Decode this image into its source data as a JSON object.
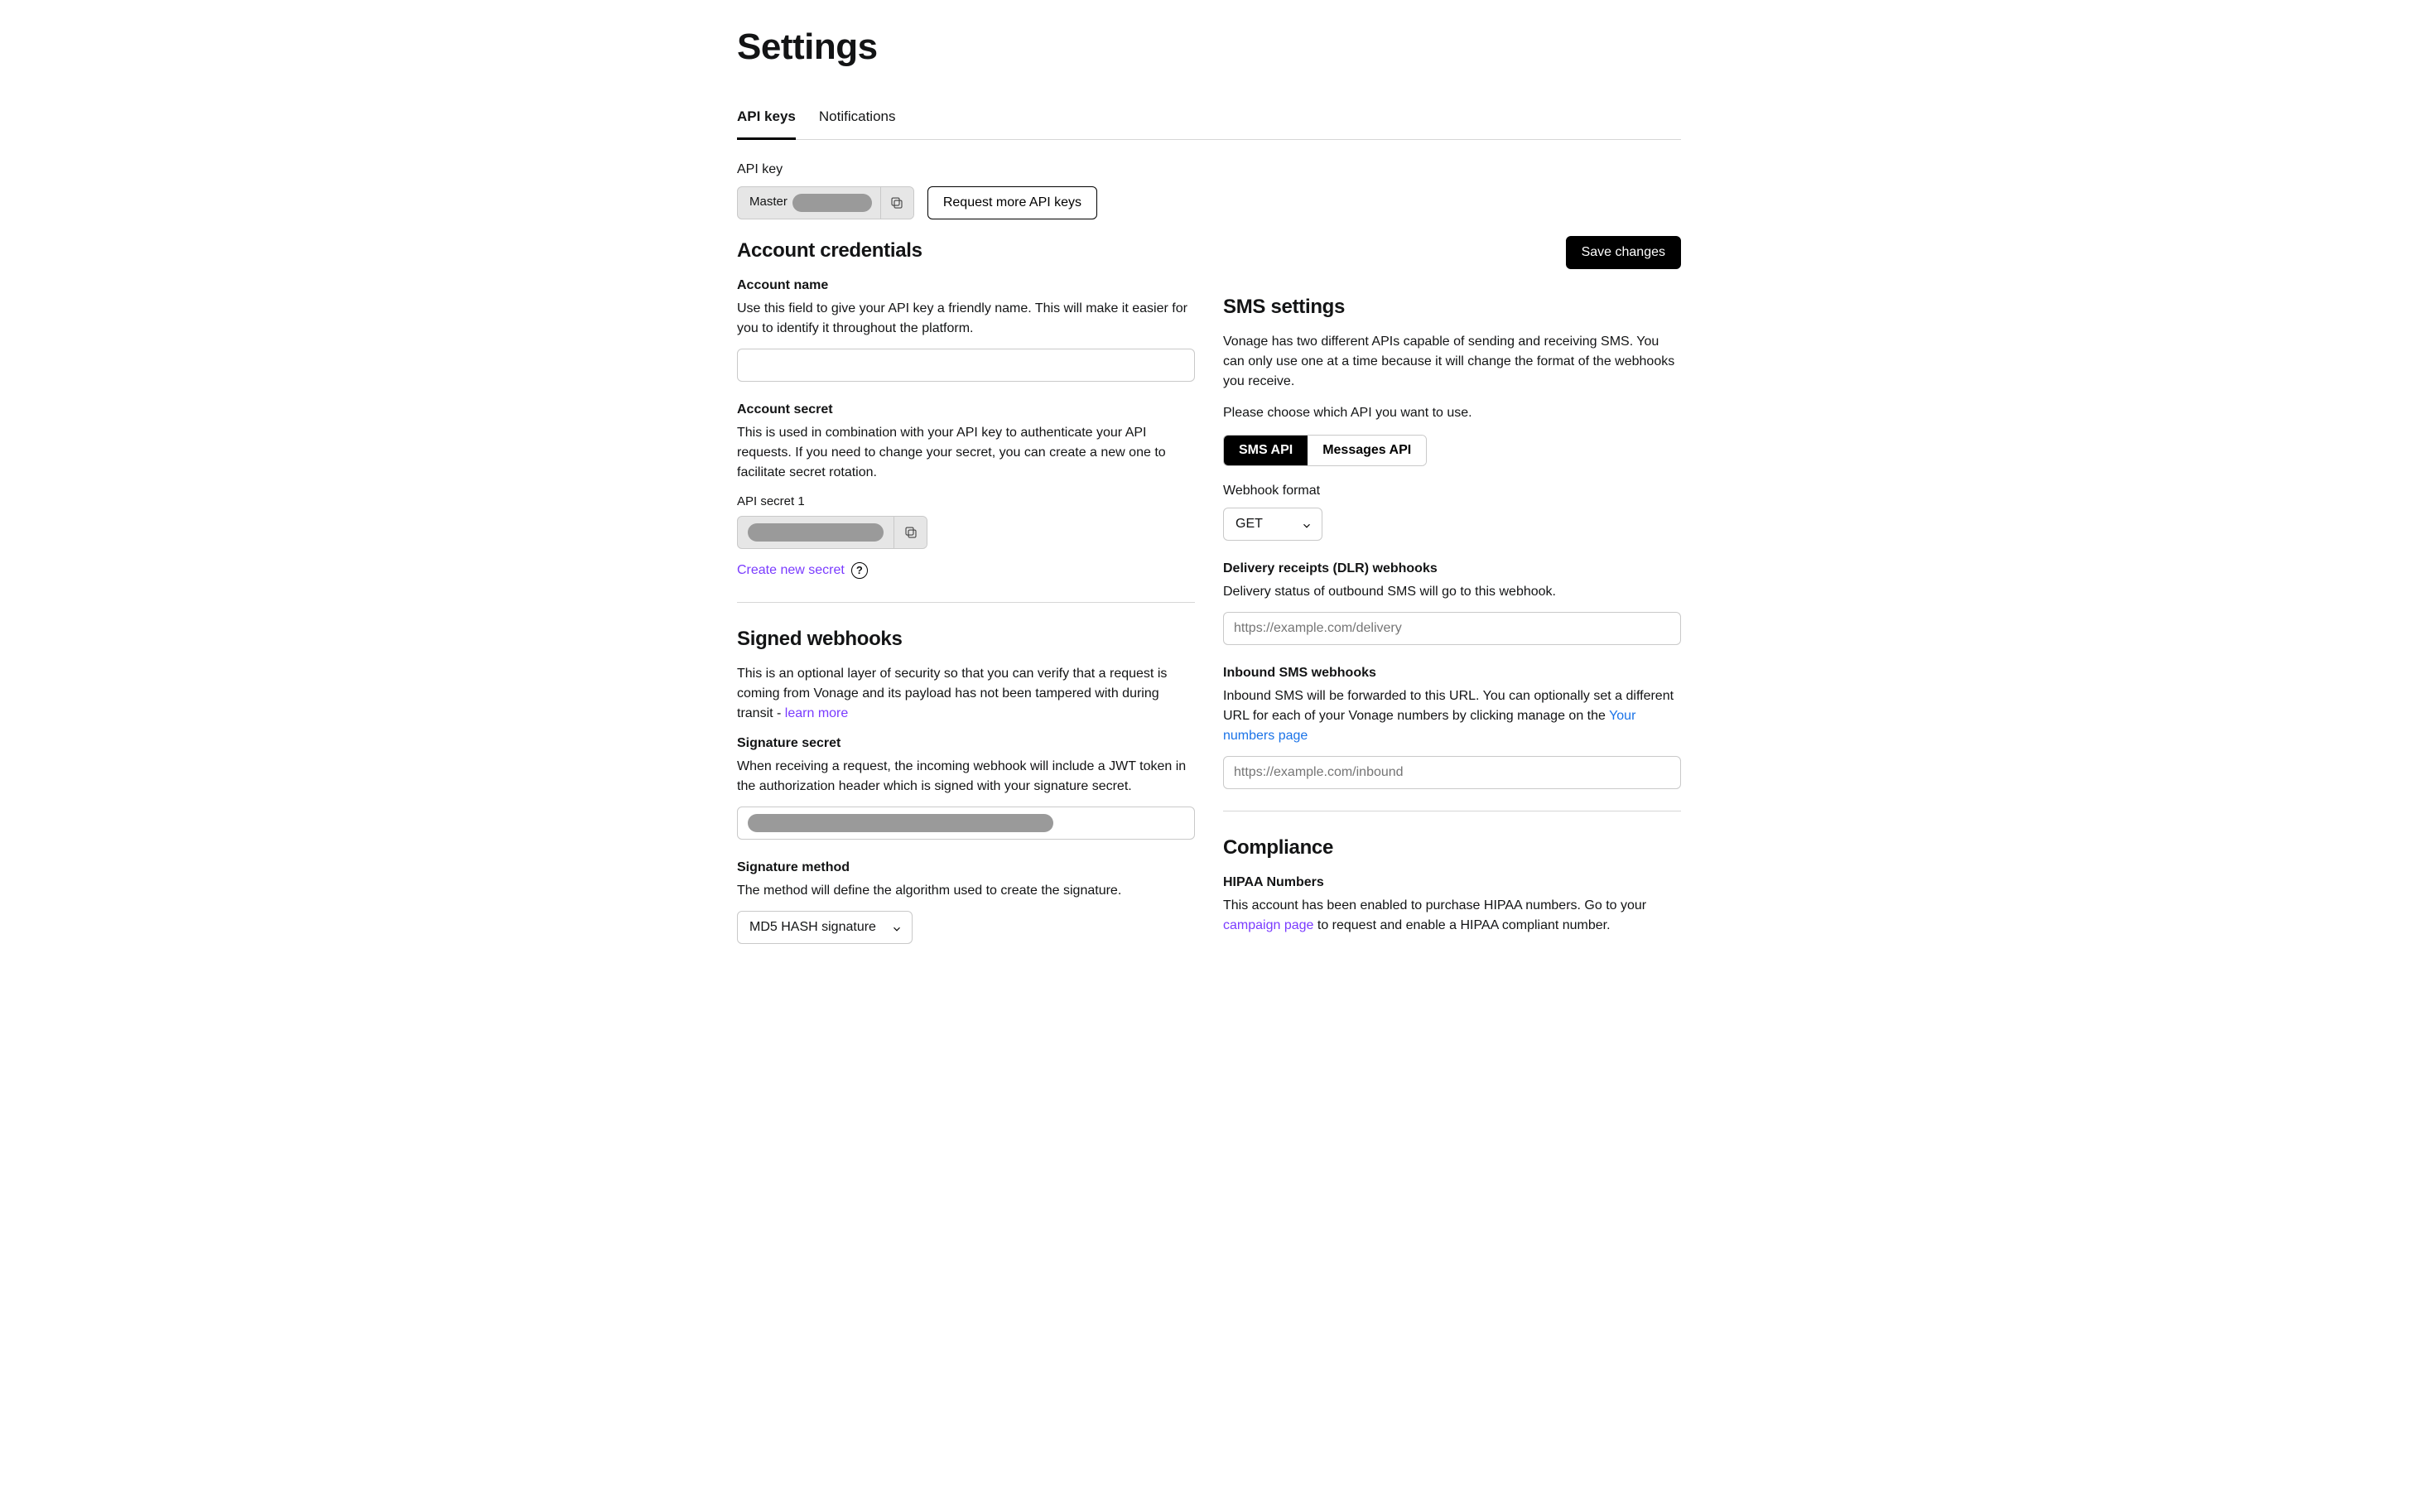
{
  "title": "Settings",
  "tabs": [
    "API keys",
    "Notifications"
  ],
  "apiKey": {
    "label": "API key",
    "prefix": "Master",
    "requestMore": "Request more API keys"
  },
  "saveButton": "Save changes",
  "account": {
    "heading": "Account credentials",
    "name": {
      "label": "Account name",
      "desc": "Use this field to give your API key a friendly name. This will make it easier for you to identify it throughout the platform."
    },
    "secret": {
      "label": "Account secret",
      "desc": "This is used in combination with your API key to authenticate your API requests. If you need to change your secret, you can create a new one to facilitate secret rotation.",
      "apiSecretLabel": "API secret 1",
      "createNew": "Create new secret"
    }
  },
  "signed": {
    "heading": "Signed webhooks",
    "desc1": "This is an optional layer of security so that you can verify that a request is coming from Vonage and its payload has not been tampered with during transit - ",
    "learnMore": "learn more",
    "sigSecret": {
      "label": "Signature secret",
      "desc": "When receiving a request, the incoming webhook will include a JWT token in the authorization header which is signed with your signature secret."
    },
    "method": {
      "label": "Signature method",
      "desc": "The method will define the algorithm used to create the signature.",
      "value": "MD5 HASH signature"
    }
  },
  "sms": {
    "heading": "SMS settings",
    "desc": "Vonage has two different APIs capable of sending and receiving SMS. You can only use one at a time because it will change the format of the webhooks you receive.",
    "choose": "Please choose which API you want to use.",
    "opts": [
      "SMS API",
      "Messages API"
    ],
    "webhookFormatLabel": "Webhook format",
    "webhookFormatValue": "GET",
    "dlr": {
      "label": "Delivery receipts (DLR) webhooks",
      "desc": "Delivery status of outbound SMS will go to this webhook.",
      "placeholder": "https://example.com/delivery"
    },
    "inbound": {
      "label": "Inbound SMS webhooks",
      "descPrefix": "Inbound SMS will be forwarded to this URL. You can optionally set a different URL for each of your Vonage numbers by clicking manage on the ",
      "link": "Your numbers page",
      "placeholder": "https://example.com/inbound"
    }
  },
  "compliance": {
    "heading": "Compliance",
    "hipaa": {
      "label": "HIPAA Numbers",
      "descPrefix": "This account has been enabled to purchase HIPAA numbers. Go to your ",
      "link": "campaign page",
      "descSuffix": " to request and enable a HIPAA compliant number."
    }
  }
}
